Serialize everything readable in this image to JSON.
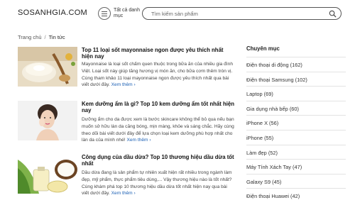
{
  "header": {
    "logo": "SOSANHGIA.COM",
    "menu_label": "Tất cả danh mục",
    "search_placeholder": "Tìm kiếm sản phẩm"
  },
  "breadcrumb": {
    "home": "Trang chủ",
    "separator": "/",
    "current": "Tin tức"
  },
  "articles": [
    {
      "title": "Top 11 loại sốt mayonnaise ngon được yêu thích nhất hiện nay",
      "desc": "Mayonnaise là loại sốt chấm quen thuộc trong bữa ăn của nhiều gia đình Việt. Loại sốt này giúp tăng hương vị món ăn, cho bữa cơm thêm tròn vị. Cùng tham khảo 11 loại mayonnaise ngon được yêu thích nhất qua bài viết dưới đây.",
      "more": "Xem thêm",
      "image": "mayonnaise-bowl"
    },
    {
      "title": "Kem dưỡng ẩm là gì? Top 10 kem dưỡng ẩm tốt nhất hiện nay",
      "desc": "Dưỡng ẩm cho da được xem là bước skincare không thể bỏ qua nếu bạn muốn sở hữu làn da căng bóng, mịn màng, khỏe và sáng chắc. Hãy cùng theo dõi bài viết dưới đây để lựa chọn loại kem dưỡng phù hợp nhất cho làn da của mình nhé!",
      "more": "Xem thêm",
      "image": "woman-moisturizer"
    },
    {
      "title": "Công dụng của dầu dừa? Top 10 thương hiệu dầu dừa tốt nhất",
      "desc": "Dầu dừa đang là sản phẩm tự nhiên xuất hiện rất nhiều trong ngành làm đẹp, mỹ phẩm, thực phẩm tiêu dùng,... Vậy thương hiệu nào là tốt nhất? Cùng khám phá top 10 thương hiệu dầu dừa tốt nhất hiện nay qua bài viết dưới đây.",
      "more": "Xem thêm",
      "image": "coconut-oil"
    }
  ],
  "sidebar": {
    "title": "Chuyên mục",
    "items": [
      "Điện thoại di động (162)",
      "Điện thoại Samsung (102)",
      "Laptop (69)",
      "Gia dụng nhà bếp (60)",
      "iPhone X (56)",
      "iPhone (55)",
      "Làm đẹp (52)",
      "Máy Tính Xách Tay (47)",
      "Galaxy S9 (45)",
      "Điện thoại Huawei (42)"
    ]
  },
  "colors": {
    "link": "#1a5fb4",
    "divider": "#e3e3e3"
  }
}
